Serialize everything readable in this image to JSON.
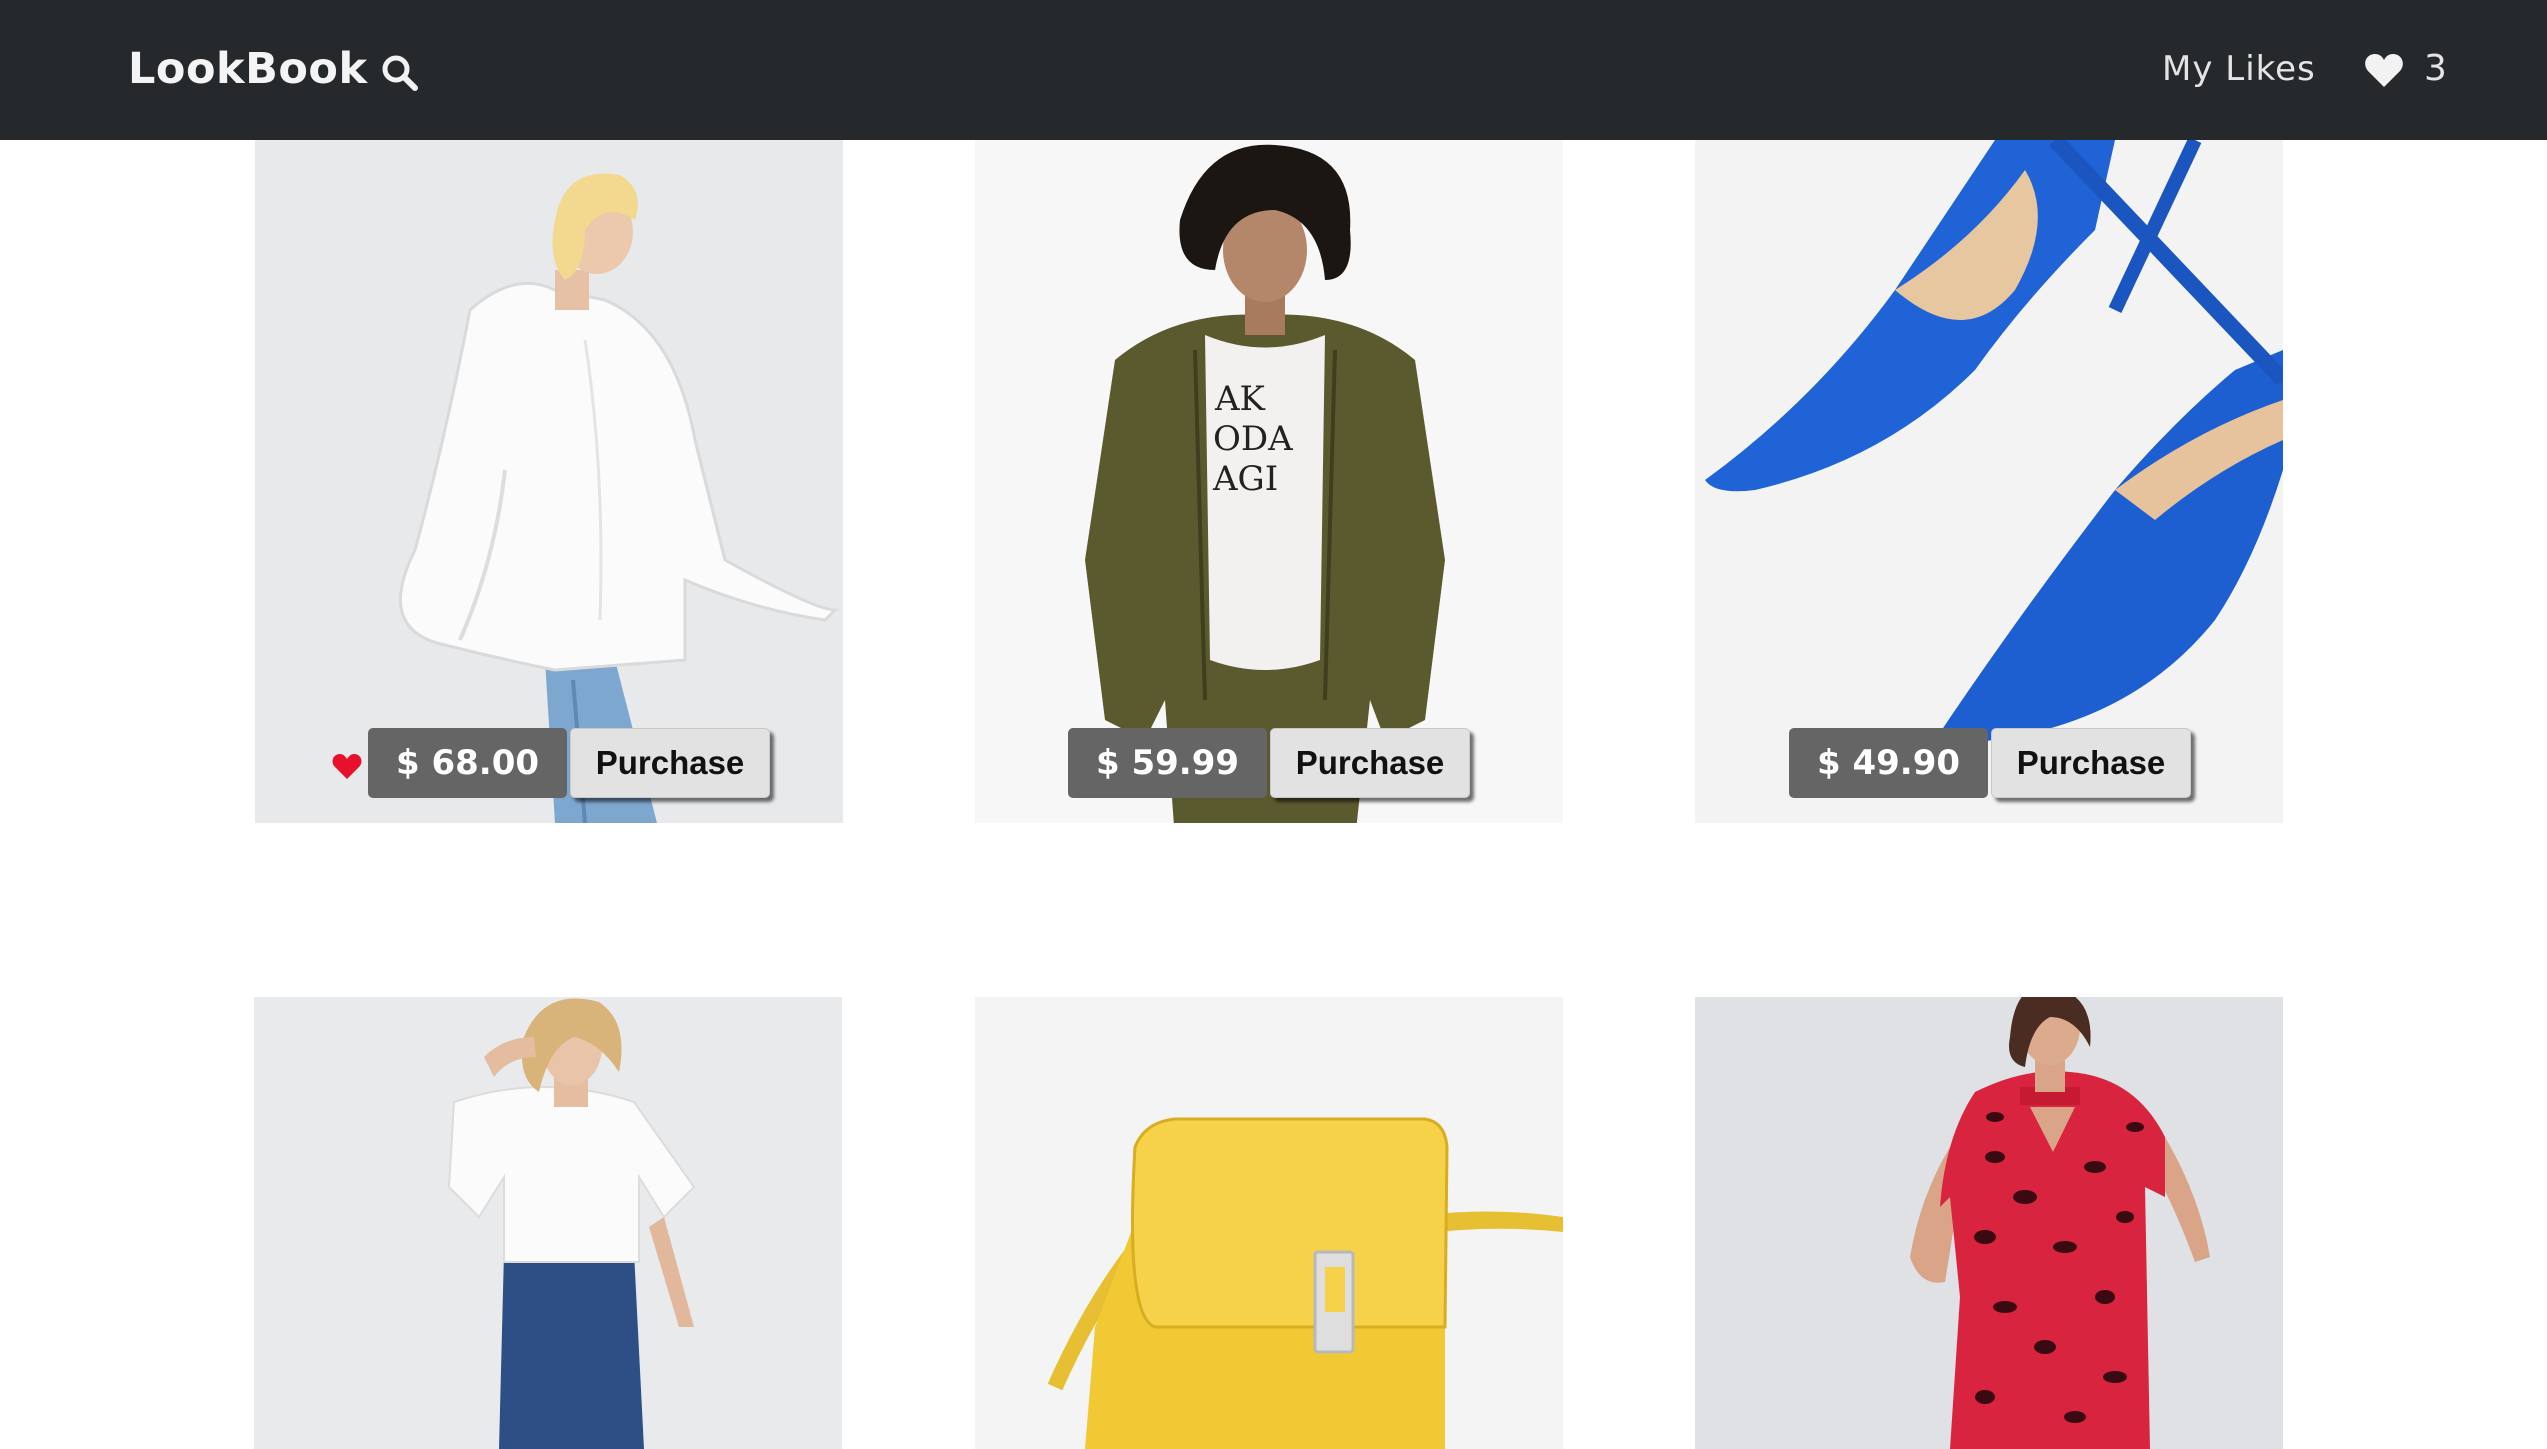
{
  "navbar": {
    "brand": "LookBook",
    "my_likes_label": "My Likes",
    "likes_count": "3",
    "search_icon": "search-icon",
    "likes_icon": "heart-icon"
  },
  "colors": {
    "navbar_bg": "#25292c",
    "price_tag_bg": "#656565",
    "purchase_bg": "#e2e2e2",
    "liked_heart": "#e8112d"
  },
  "products": [
    {
      "item": "white bell-sleeve shirt",
      "price": "$ 68.00",
      "action": "Purchase",
      "liked": true
    },
    {
      "item": "olive utility jacket",
      "price": "$ 59.99",
      "action": "Purchase",
      "liked": false
    },
    {
      "item": "blue satin pumps",
      "price": "$ 49.90",
      "action": "Purchase",
      "liked": false
    },
    {
      "item": "white tee and jeans",
      "item_price_visible": false
    },
    {
      "item": "yellow crossbody bag",
      "item_price_visible": false
    },
    {
      "item": "red leopard dress",
      "item_price_visible": false
    }
  ]
}
